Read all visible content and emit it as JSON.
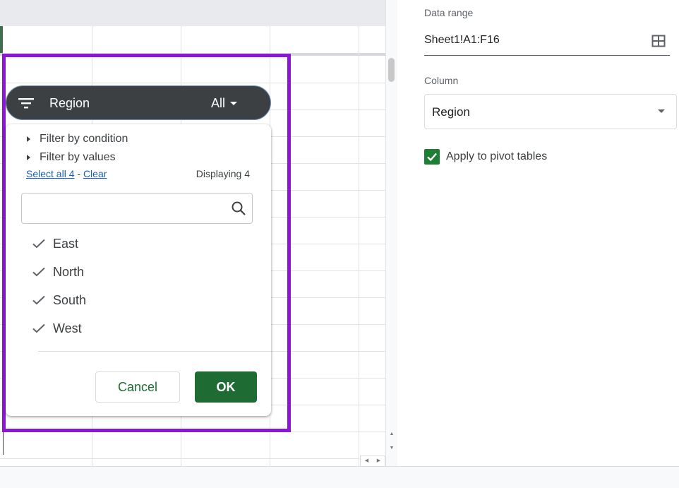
{
  "side_panel": {
    "data_range_label": "Data range",
    "data_range_value": "Sheet1!A1:F16",
    "column_label": "Column",
    "column_value": "Region",
    "apply_pivot_label": "Apply to pivot tables",
    "apply_pivot_checked": true
  },
  "filter": {
    "chip_title": "Region",
    "chip_selection": "All",
    "filter_by_condition": "Filter by condition",
    "filter_by_values": "Filter by values",
    "select_all": "Select all 4",
    "separator": "-",
    "clear": "Clear",
    "displaying": "Displaying 4",
    "search_value": "",
    "values": [
      {
        "label": "East",
        "checked": true
      },
      {
        "label": "North",
        "checked": true
      },
      {
        "label": "South",
        "checked": true
      },
      {
        "label": "West",
        "checked": true
      }
    ],
    "cancel_label": "Cancel",
    "ok_label": "OK"
  },
  "colors": {
    "accent_green": "#1e6b34",
    "highlight_purple": "#8a17d6",
    "chip_bg": "#3c4043",
    "link_blue": "#1a5fb4"
  }
}
